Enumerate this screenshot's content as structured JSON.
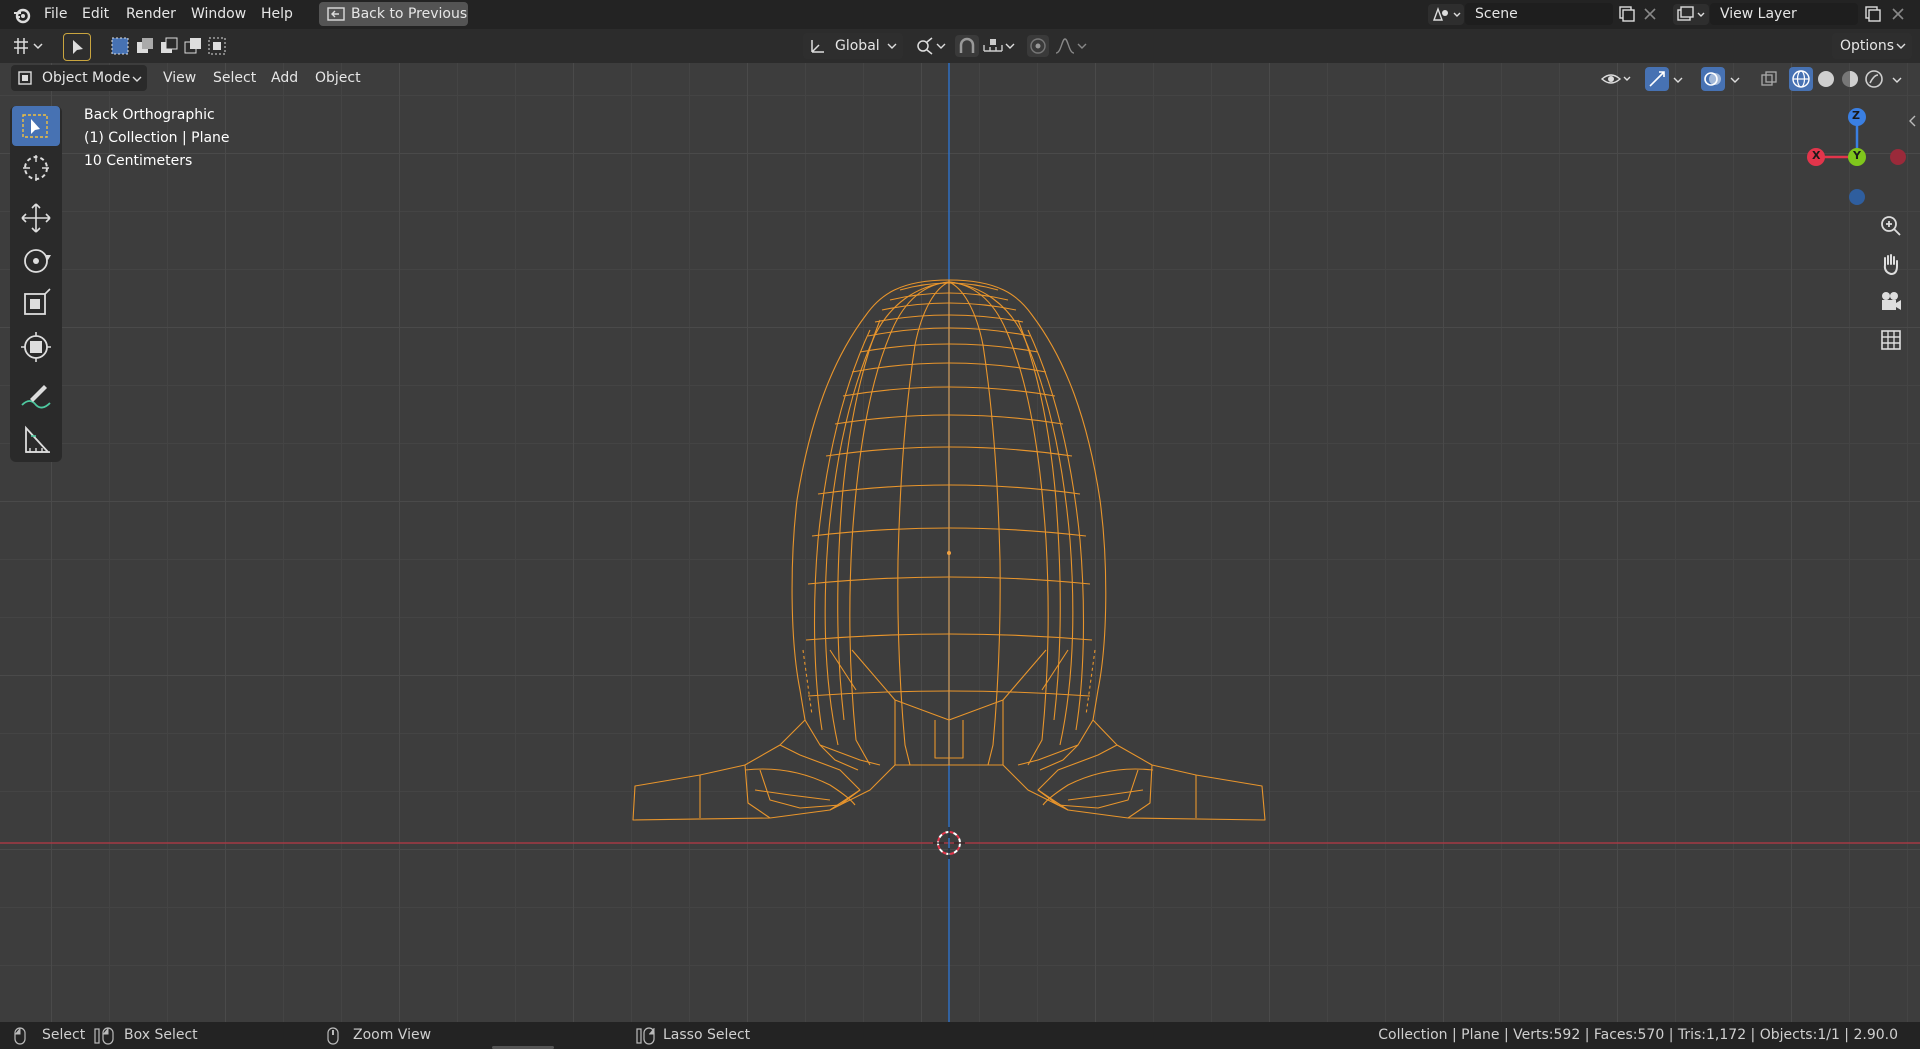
{
  "topbar": {
    "menus": [
      "File",
      "Edit",
      "Render",
      "Window",
      "Help"
    ],
    "back_button": "Back to Previous",
    "scene": "Scene",
    "view_layer": "View Layer"
  },
  "tool_header": {
    "orientation": "Global",
    "options": "Options"
  },
  "viewport_header": {
    "mode": "Object Mode",
    "menus": [
      "View",
      "Select",
      "Add",
      "Object"
    ]
  },
  "overlay": {
    "view_name": "Back Orthographic",
    "collection": "(1) Collection | Plane",
    "scale": "10 Centimeters"
  },
  "gizmo": {
    "z": "Z",
    "x": "X",
    "y": "Y"
  },
  "statusbar": {
    "select": "Select",
    "box_select": "Box Select",
    "zoom_view": "Zoom View",
    "lasso_select": "Lasso Select",
    "stats": "Collection | Plane | Verts:592 | Faces:570 | Tris:1,172 | Objects:1/1 | 2.90.0"
  },
  "colors": {
    "accent": "#4772b3",
    "wire": "#e8952c",
    "x_axis": "#e2354b",
    "y_axis": "#7fc61c",
    "z_axis": "#3a7fe2"
  }
}
